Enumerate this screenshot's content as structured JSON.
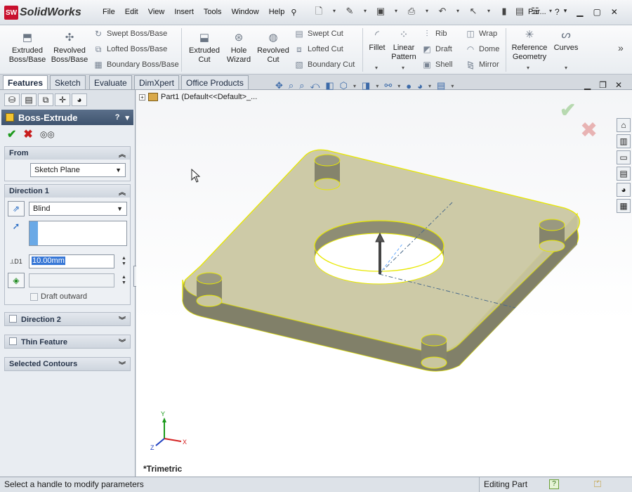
{
  "app": {
    "brand_badge": "SW",
    "brand_name": "SolidWorks"
  },
  "menu": [
    "File",
    "Edit",
    "View",
    "Insert",
    "Tools",
    "Window",
    "Help"
  ],
  "title": {
    "document": "Par..."
  },
  "command_manager": {
    "extruded_boss": "Extruded Boss/Base",
    "revolved_boss": "Revolved Boss/Base",
    "swept_boss": "Swept Boss/Base",
    "lofted_boss": "Lofted Boss/Base",
    "boundary_boss": "Boundary Boss/Base",
    "extruded_cut": "Extruded Cut",
    "hole_wizard": "Hole Wizard",
    "revolved_cut": "Revolved Cut",
    "swept_cut": "Swept Cut",
    "lofted_cut": "Lofted Cut",
    "boundary_cut": "Boundary Cut",
    "fillet": "Fillet",
    "linear_pattern": "Linear Pattern",
    "rib": "Rib",
    "draft": "Draft",
    "shell": "Shell",
    "wrap": "Wrap",
    "dome": "Dome",
    "mirror": "Mirror",
    "reference_geometry": "Reference Geometry",
    "curves": "Curves"
  },
  "tabs": [
    "Features",
    "Sketch",
    "Evaluate",
    "DimXpert",
    "Office Products"
  ],
  "property_manager": {
    "title": "Boss-Extrude",
    "from": {
      "label": "From",
      "value": "Sketch Plane"
    },
    "direction1": {
      "label": "Direction 1",
      "end_condition": "Blind",
      "depth": "10.00mm",
      "depth_symbol": "D1",
      "draft_outward": "Draft outward"
    },
    "direction2": {
      "label": "Direction 2"
    },
    "thin_feature": {
      "label": "Thin Feature"
    },
    "selected_contours": {
      "label": "Selected Contours"
    }
  },
  "viewport": {
    "tree_item": "Part1  (Default<<Default>_...",
    "view_name": "*Trimetric",
    "triad": {
      "x": "X",
      "y": "Y",
      "z": "Z"
    }
  },
  "status_bar": {
    "message": "Select a handle to modify parameters",
    "mode": "Editing Part"
  },
  "colors": {
    "part_face": "#c9c6a0",
    "part_edge": "#e8e800",
    "accent": "#3f536e"
  },
  "icons": [
    "save-icon",
    "print-icon",
    "undo-icon",
    "select-icon",
    "rebuild-icon",
    "options-icon",
    "help-icon"
  ]
}
